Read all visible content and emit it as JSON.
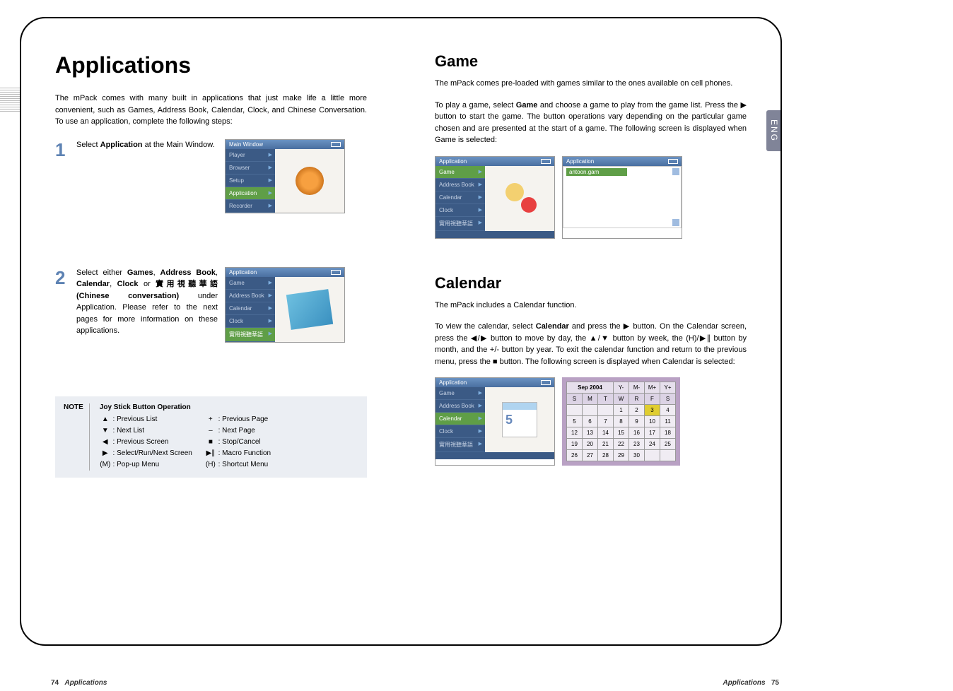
{
  "left": {
    "title": "Applications",
    "intro": "The mPack comes with many built in applications that just make life a little more convenient, such as Games, Address Book, Calendar, Clock, and Chinese Conversation. To use an application, complete the following steps:",
    "step1_num": "1",
    "step1_text_a": "Select ",
    "step1_text_b": "Application",
    "step1_text_c": " at the Main Window.",
    "step2_num": "2",
    "step2_text_a": "Select either ",
    "step2_text_b": "Games",
    "step2_text_c": ", ",
    "step2_text_d": "Address Book",
    "step2_text_e": ", ",
    "step2_text_f": "Calendar",
    "step2_text_g": ", ",
    "step2_text_h": "Clock",
    "step2_text_i": " or ",
    "step2_text_j": "實用視聽華語(Chinese conversation)",
    "step2_text_k": " under Application. Please refer to the next pages for more information on these applications.",
    "main_window": {
      "title": "Main Window",
      "items": [
        "Player",
        "Browser",
        "Setup",
        "Application",
        "Recorder"
      ],
      "selected": 3
    },
    "app_window": {
      "title": "Application",
      "items": [
        "Game",
        "Address Book",
        "Calendar",
        "Clock",
        "實用視聽華語"
      ],
      "selected": 4
    },
    "note": {
      "label": "NOTE",
      "title": "Joy Stick Button Operation",
      "col1": [
        {
          "sym": "▲",
          "desc": ": Previous List"
        },
        {
          "sym": "▼",
          "desc": ": Next List"
        },
        {
          "sym": "◀",
          "desc": ": Previous Screen"
        },
        {
          "sym": "▶",
          "desc": ": Select/Run/Next Screen"
        },
        {
          "sym": "(M)",
          "desc": ": Pop-up Menu"
        }
      ],
      "col2": [
        {
          "sym": "+",
          "desc": ": Previous Page"
        },
        {
          "sym": "–",
          "desc": ": Next Page"
        },
        {
          "sym": "■",
          "desc": ": Stop/Cancel"
        },
        {
          "sym": "▶∥",
          "desc": ": Macro Function"
        },
        {
          "sym": "(H)",
          "desc": ": Shortcut Menu"
        }
      ]
    }
  },
  "right": {
    "game_h": "Game",
    "game_p1": "The mPack comes pre-loaded with games similar to the ones available on cell phones.",
    "game_p2a": "To play a game, select ",
    "game_p2b": "Game",
    "game_p2c": " and choose a game to play from the game list. Press the ▶ button to start the game. The button operations vary depending on the particular game chosen and are presented at the start of a game. The following screen is displayed when Game is selected:",
    "game_screen1": {
      "title": "Application",
      "items": [
        "Game",
        "Address Book",
        "Calendar",
        "Clock",
        "實用視聽華語"
      ],
      "selected": 0
    },
    "game_screen2": {
      "title": "Application",
      "file": "antoon.gam"
    },
    "cal_h": "Calendar",
    "cal_p1": "The mPack includes a Calendar function.",
    "cal_p2a": "To view the calendar, select ",
    "cal_p2b": "Calendar",
    "cal_p2c": " and press the ▶ button. On the Calendar screen, press the ◀/▶ button to move by day, the ▲/▼ button by week, the (H)/▶∥ button by month, and the +/- button by year. To exit the calendar function and return to the previous menu, press the ■ button. The following screen is displayed when Calendar is selected:",
    "cal_screen": {
      "title": "Application",
      "items": [
        "Game",
        "Address Book",
        "Calendar",
        "Clock",
        "實用視聽華語"
      ],
      "selected": 2
    },
    "calendar": {
      "month_label": "Sep 2004",
      "nav": [
        "Y-",
        "M-",
        "M+",
        "Y+"
      ],
      "days": [
        "S",
        "M",
        "T",
        "W",
        "R",
        "F",
        "S"
      ],
      "rows": [
        [
          "",
          "",
          "",
          "1",
          "2",
          "3",
          "4"
        ],
        [
          "5",
          "6",
          "7",
          "8",
          "9",
          "10",
          "11"
        ],
        [
          "12",
          "13",
          "14",
          "15",
          "16",
          "17",
          "18"
        ],
        [
          "19",
          "20",
          "21",
          "22",
          "23",
          "24",
          "25"
        ],
        [
          "26",
          "27",
          "28",
          "29",
          "30",
          "",
          ""
        ]
      ],
      "highlight": "3"
    },
    "eng_tab": "ENG"
  },
  "footer": {
    "left_num": "74",
    "left_txt": "Applications",
    "right_txt": "Applications",
    "right_num": "75"
  }
}
